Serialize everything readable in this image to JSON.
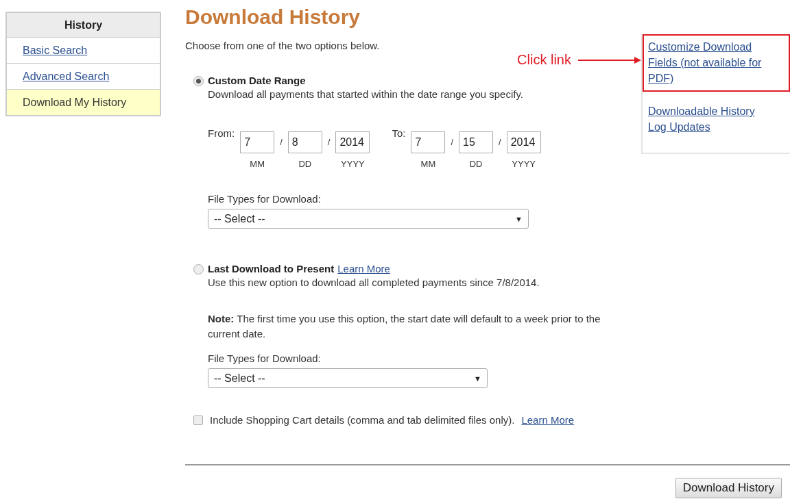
{
  "sidebar": {
    "title": "History",
    "items": [
      {
        "label": "Basic Search",
        "selected": false
      },
      {
        "label": "Advanced Search",
        "selected": false
      },
      {
        "label": "Download My History",
        "selected": true
      }
    ]
  },
  "page_title": "Download History",
  "intro": "Choose from one of the two options below.",
  "options": [
    {
      "kind": "date_range",
      "label": "Custom Date Range",
      "selected": true,
      "description": "Download all payments that started within the date range you specify.",
      "dates": [
        {
          "label": "From:",
          "month": "7",
          "day": "8",
          "year": "2014",
          "separators": [
            "/",
            "/"
          ],
          "hints": [
            "MM",
            "DD",
            "YYYY"
          ]
        },
        {
          "label": "To:",
          "month": "7",
          "day": "15",
          "year": "2014",
          "separators": [
            "/",
            "/"
          ],
          "hints": [
            "MM",
            "DD",
            "YYYY"
          ]
        }
      ],
      "file_types": {
        "label": "File Types for Download:",
        "value": "-- Select --",
        "caret": "▼"
      }
    },
    {
      "kind": "since_last",
      "label": "Last Download to Present",
      "selected": false,
      "link": "Learn More",
      "description": "Use this new option to download all completed payments since 7/8/2014.",
      "note": "**Note:** The first time you use this option, the start date will default to a week prior to the current date.",
      "file_types": {
        "label": "File Types for Download:",
        "value": "-- Select --",
        "caret": "▼"
      }
    }
  ],
  "shopping_cart": {
    "label": "Include Shopping Cart details (comma and tab delimited files only).",
    "checked": false,
    "link": "Learn More"
  },
  "side_links": [
    {
      "label": "Customize Download Fields (not available for PDF)",
      "highlighted": true
    },
    {
      "label": "Downloadable History Log Updates",
      "highlighted": false
    }
  ],
  "annotation": {
    "text": "Click link"
  },
  "download_button": "Download History"
}
